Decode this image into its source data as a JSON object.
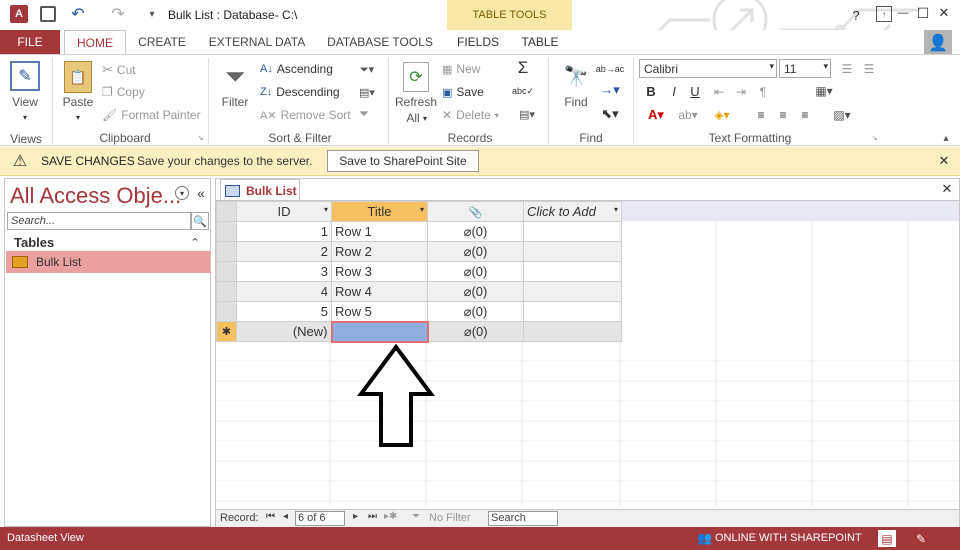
{
  "window": {
    "title": "Bulk List : Database- C:\\",
    "table_tools": "TABLE TOOLS",
    "help": "?",
    "minimize": "—",
    "restore": "☐",
    "close": "✕"
  },
  "tabs": {
    "file": "FILE",
    "home": "HOME",
    "create": "CREATE",
    "external": "EXTERNAL DATA",
    "dbtools": "DATABASE TOOLS",
    "fields": "FIELDS",
    "table": "TABLE"
  },
  "ribbon": {
    "views": {
      "view": "View",
      "group": "Views"
    },
    "clipboard": {
      "paste": "Paste",
      "cut": "Cut",
      "copy": "Copy",
      "format_painter": "Format Painter",
      "group": "Clipboard"
    },
    "sortfilter": {
      "filter": "Filter",
      "ascending": "Ascending",
      "descending": "Descending",
      "remove_sort": "Remove Sort",
      "group": "Sort & Filter"
    },
    "records": {
      "refresh": "Refresh",
      "all": "All",
      "new": "New",
      "save": "Save",
      "delete": "Delete",
      "group": "Records"
    },
    "find": {
      "find": "Find",
      "group": "Find"
    },
    "textfmt": {
      "font": "Calibri",
      "size": "11",
      "bold": "B",
      "italic": "I",
      "underline": "U",
      "group": "Text Formatting"
    }
  },
  "message_bar": {
    "title": "SAVE CHANGES",
    "text": "Save your changes to the server.",
    "button": "Save to SharePoint Site"
  },
  "nav": {
    "title": "All Access Obje...",
    "search_placeholder": "Search...",
    "section": "Tables",
    "item": "Bulk List"
  },
  "doc_tab": "Bulk List",
  "grid": {
    "columns": [
      "ID",
      "Title",
      "📎",
      "Click to Add"
    ],
    "rows": [
      {
        "id": "1",
        "title": "Row 1",
        "att": "(0)"
      },
      {
        "id": "2",
        "title": "Row 2",
        "att": "(0)"
      },
      {
        "id": "3",
        "title": "Row 3",
        "att": "(0)"
      },
      {
        "id": "4",
        "title": "Row 4",
        "att": "(0)"
      },
      {
        "id": "5",
        "title": "Row 5",
        "att": "(0)"
      }
    ],
    "new_row": {
      "id": "(New)",
      "att": "(0)"
    }
  },
  "record_nav": {
    "label": "Record:",
    "position": "6 of 6",
    "no_filter": "No Filter",
    "search": "Search"
  },
  "status": {
    "left": "Datasheet View",
    "online": "ONLINE WITH SHAREPOINT"
  },
  "colors": {
    "accent": "#a4373a",
    "header_yellow": "#f7e8a8",
    "selected_cell": "#8fb0e0"
  }
}
